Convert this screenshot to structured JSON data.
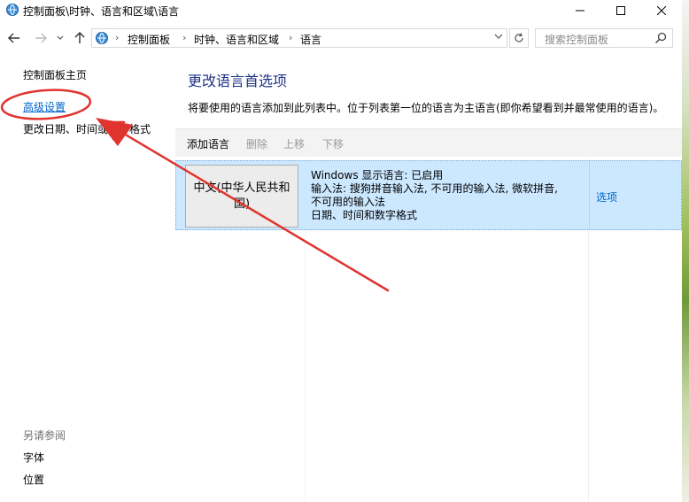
{
  "window": {
    "title": "控制面板\\时钟、语言和区域\\语言"
  },
  "nav": {
    "breadcrumbs": [
      "控制面板",
      "时钟、语言和区域",
      "语言"
    ],
    "search_placeholder": "搜索控制面板"
  },
  "sidebar": {
    "home": "控制面板主页",
    "advanced": "高级设置",
    "date_time": "更改日期、时间或数字格式",
    "see_also": "另请参阅",
    "fonts": "字体",
    "location": "位置"
  },
  "main": {
    "title": "更改语言首选项",
    "description": "将要使用的语言添加到此列表中。位于列表第一位的语言为主语言(即你希望看到并最常使用的语言)。",
    "toolbar": {
      "add": "添加语言",
      "remove": "删除",
      "move_up": "上移",
      "move_down": "下移"
    },
    "languages": [
      {
        "name": "中文(中华人民共和国)",
        "info": [
          "Windows 显示语言: 已启用",
          "输入法: 搜狗拼音输入法, 不可用的输入法, 微软拼音,",
          "不可用的输入法",
          "日期、时间和数字格式"
        ],
        "options": "选项"
      }
    ]
  },
  "colors": {
    "selected_row": "#cce8ff",
    "link": "#0066cc",
    "title": "#1e3287",
    "annotation": "#e0342f"
  },
  "icons": [
    "control-panel-icon",
    "minimize-icon",
    "maximize-icon",
    "close-icon",
    "back-arrow-icon",
    "forward-arrow-icon",
    "chevron-down-icon",
    "up-arrow-icon",
    "refresh-icon",
    "search-icon"
  ]
}
